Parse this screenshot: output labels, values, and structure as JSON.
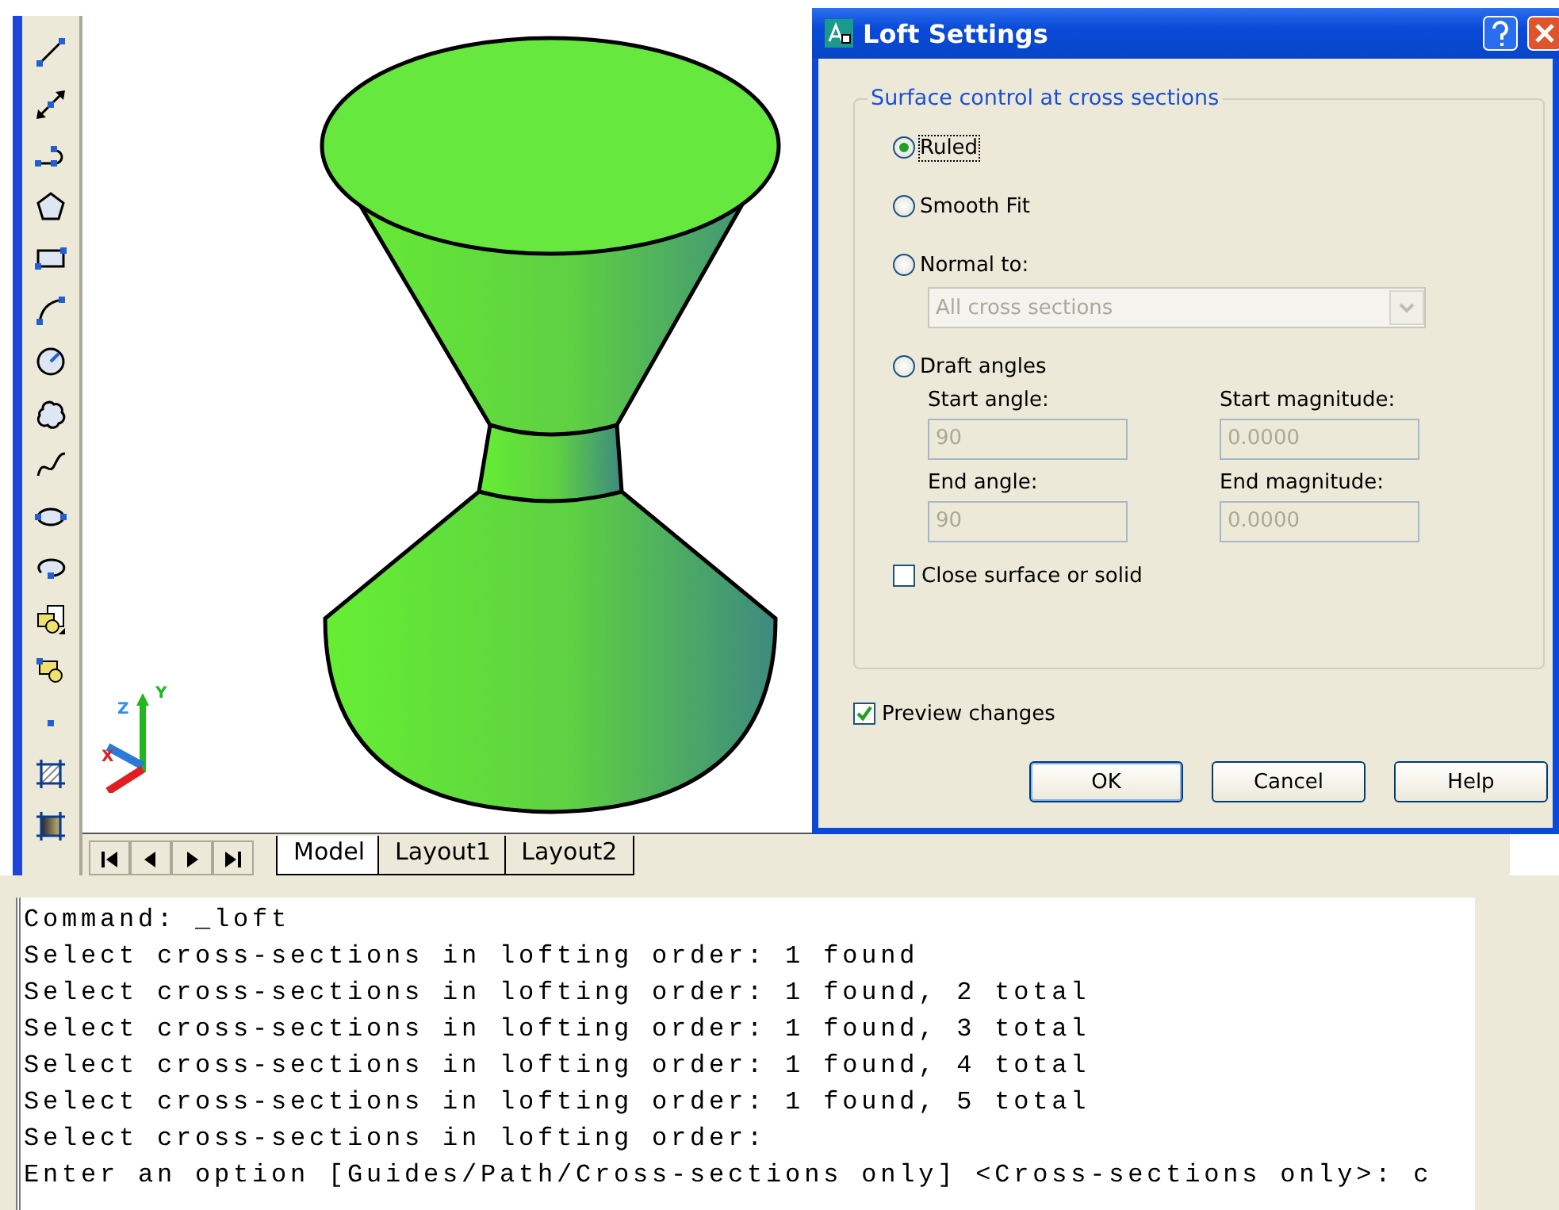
{
  "viewport": {
    "ucs_labels": [
      "Z",
      "Y",
      "X"
    ],
    "tabs": [
      {
        "label": "Model",
        "selected": true
      },
      {
        "label": "Layout1",
        "selected": false
      },
      {
        "label": "Layout2",
        "selected": false
      }
    ]
  },
  "dialog": {
    "title": "Loft Settings",
    "group_title": "Surface control at cross sections",
    "options": [
      {
        "label": "Ruled",
        "selected": true
      },
      {
        "label": "Smooth Fit",
        "selected": false
      },
      {
        "label": "Normal to:",
        "selected": false
      },
      {
        "label": "Draft angles",
        "selected": false
      }
    ],
    "dropdown": {
      "value": "All cross sections",
      "disabled": true
    },
    "fields": [
      {
        "label": "Start angle:",
        "value": "90",
        "disabled": true
      },
      {
        "label": "Start magnitude:",
        "value": "0.0000",
        "disabled": true
      },
      {
        "label": "End angle:",
        "value": "90",
        "disabled": true
      },
      {
        "label": "End magnitude:",
        "value": "0.0000",
        "disabled": true
      }
    ],
    "close_surface": {
      "label": "Close surface or solid",
      "checked": false
    },
    "preview": {
      "label": "Preview changes",
      "checked": true
    },
    "buttons": [
      "OK",
      "Cancel",
      "Help"
    ]
  },
  "command_lines": [
    "Command: _loft",
    "Select cross-sections in lofting order: 1 found",
    "Select cross-sections in lofting order: 1 found, 2 total",
    "Select cross-sections in lofting order: 1 found, 3 total",
    "Select cross-sections in lofting order: 1 found, 4 total",
    "Select cross-sections in lofting order: 1 found, 5 total",
    "Select cross-sections in lofting order:",
    "Enter an option [Guides/Path/Cross-sections only] <Cross-sections only>: c"
  ]
}
